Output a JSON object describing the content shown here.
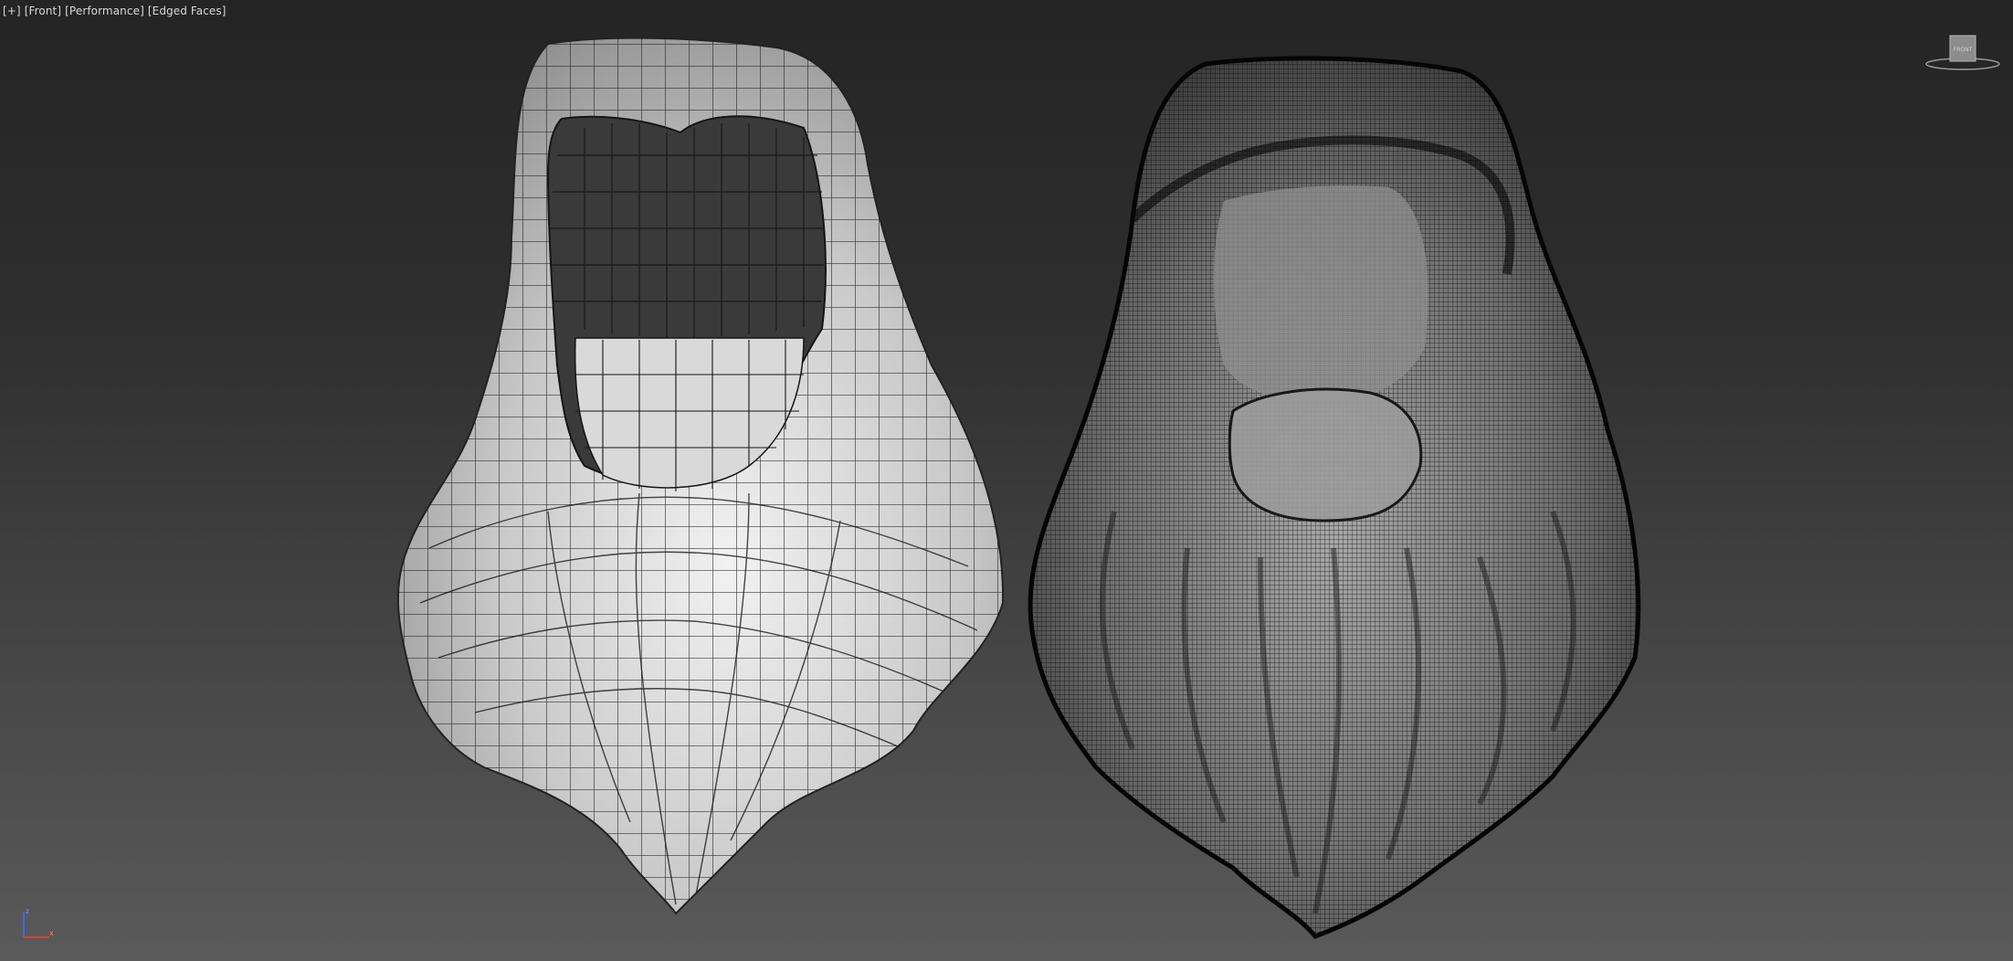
{
  "viewport": {
    "menu_plus": "[+]",
    "menu_view": "[Front]",
    "menu_mode": "[Performance]",
    "menu_shading": "[Edged Faces]"
  },
  "viewcube": {
    "face_label": "FRONT"
  },
  "axis": {
    "z_label": "z",
    "x_label": "x"
  },
  "colors": {
    "background_top": "#242424",
    "background_bottom": "#5a5a5a",
    "low_poly_surface": "#bdbdbd",
    "high_poly_surface": "#6a6a6a",
    "wire": "#111111",
    "axis_z": "#3a6bff",
    "axis_x": "#e03a3a"
  },
  "objects": [
    {
      "name": "low-poly-beard",
      "shading": "edged-faces"
    },
    {
      "name": "high-poly-beard",
      "shading": "edged-faces"
    }
  ]
}
